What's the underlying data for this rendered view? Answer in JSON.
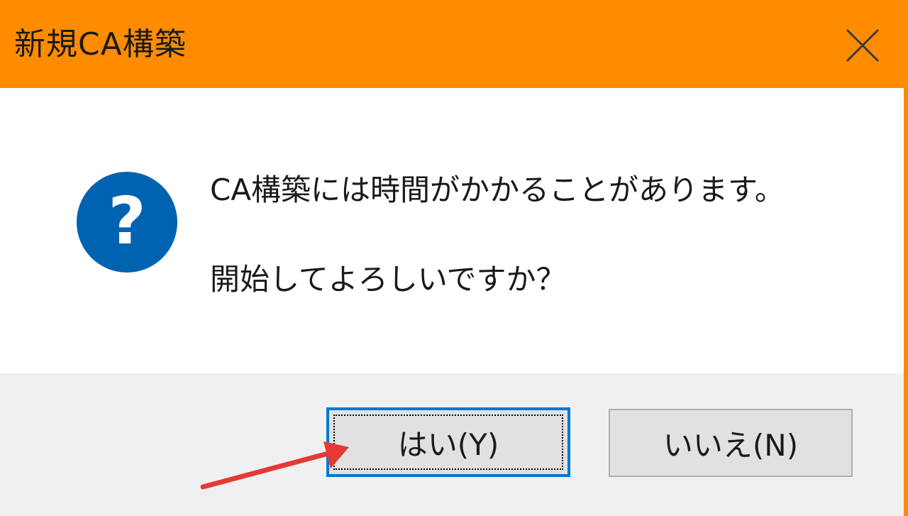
{
  "window": {
    "title": "新規CA構築",
    "close_icon": "close-icon"
  },
  "message": {
    "icon": "question-icon",
    "line1": "CA構築には時間がかかることがあります。",
    "line2": "開始してよろしいですか？"
  },
  "buttons": {
    "yes_label": "はい(Y)",
    "no_label": "いいえ(N)"
  },
  "annotation": {
    "arrow_icon": "arrow-icon",
    "arrow_color": "#e53935"
  },
  "colors": {
    "titlebar": "#ff8c00",
    "icon_blue": "#0063b1",
    "focus_border": "#0078d7"
  }
}
